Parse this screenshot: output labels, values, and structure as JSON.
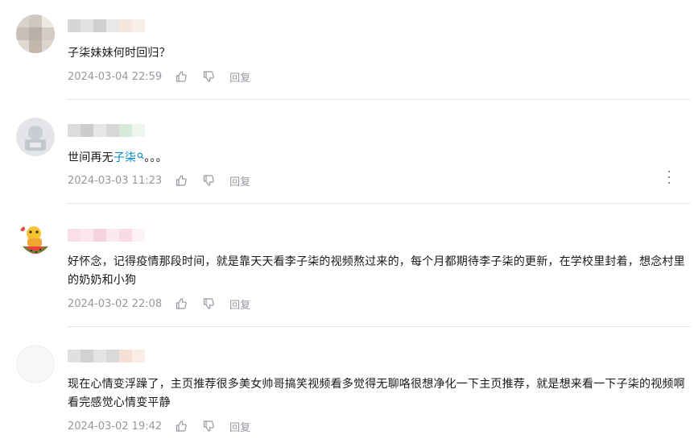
{
  "comments": [
    {
      "text": "子柒妹妹何时回归？",
      "date": "2024-03-04 22:59",
      "reply_label": "回复"
    },
    {
      "text_before": "世间再无",
      "keyword": "子柒",
      "text_after": "。。。",
      "date": "2024-03-03 11:23",
      "reply_label": "回复"
    },
    {
      "text": "好怀念，记得疫情那段时间，就是靠天天看李子柒的视频熬过来的，每个月都期待李子柒的更新，在学校里封着，想念村里的奶奶和小狗",
      "date": "2024-03-02 22:08",
      "reply_label": "回复"
    },
    {
      "text": "现在心情变浮躁了，主页推荐很多美女帅哥搞笑视频看多觉得无聊咯很想净化一下主页推荐，就是想来看一下子柒的视频啊看完感觉心情变平静",
      "date": "2024-03-02 19:42",
      "reply_label": "回复"
    }
  ],
  "colors": {
    "text": "#18191c",
    "meta": "#9499a0",
    "keyword": "#008ac5",
    "divider": "#e3e5e7"
  }
}
